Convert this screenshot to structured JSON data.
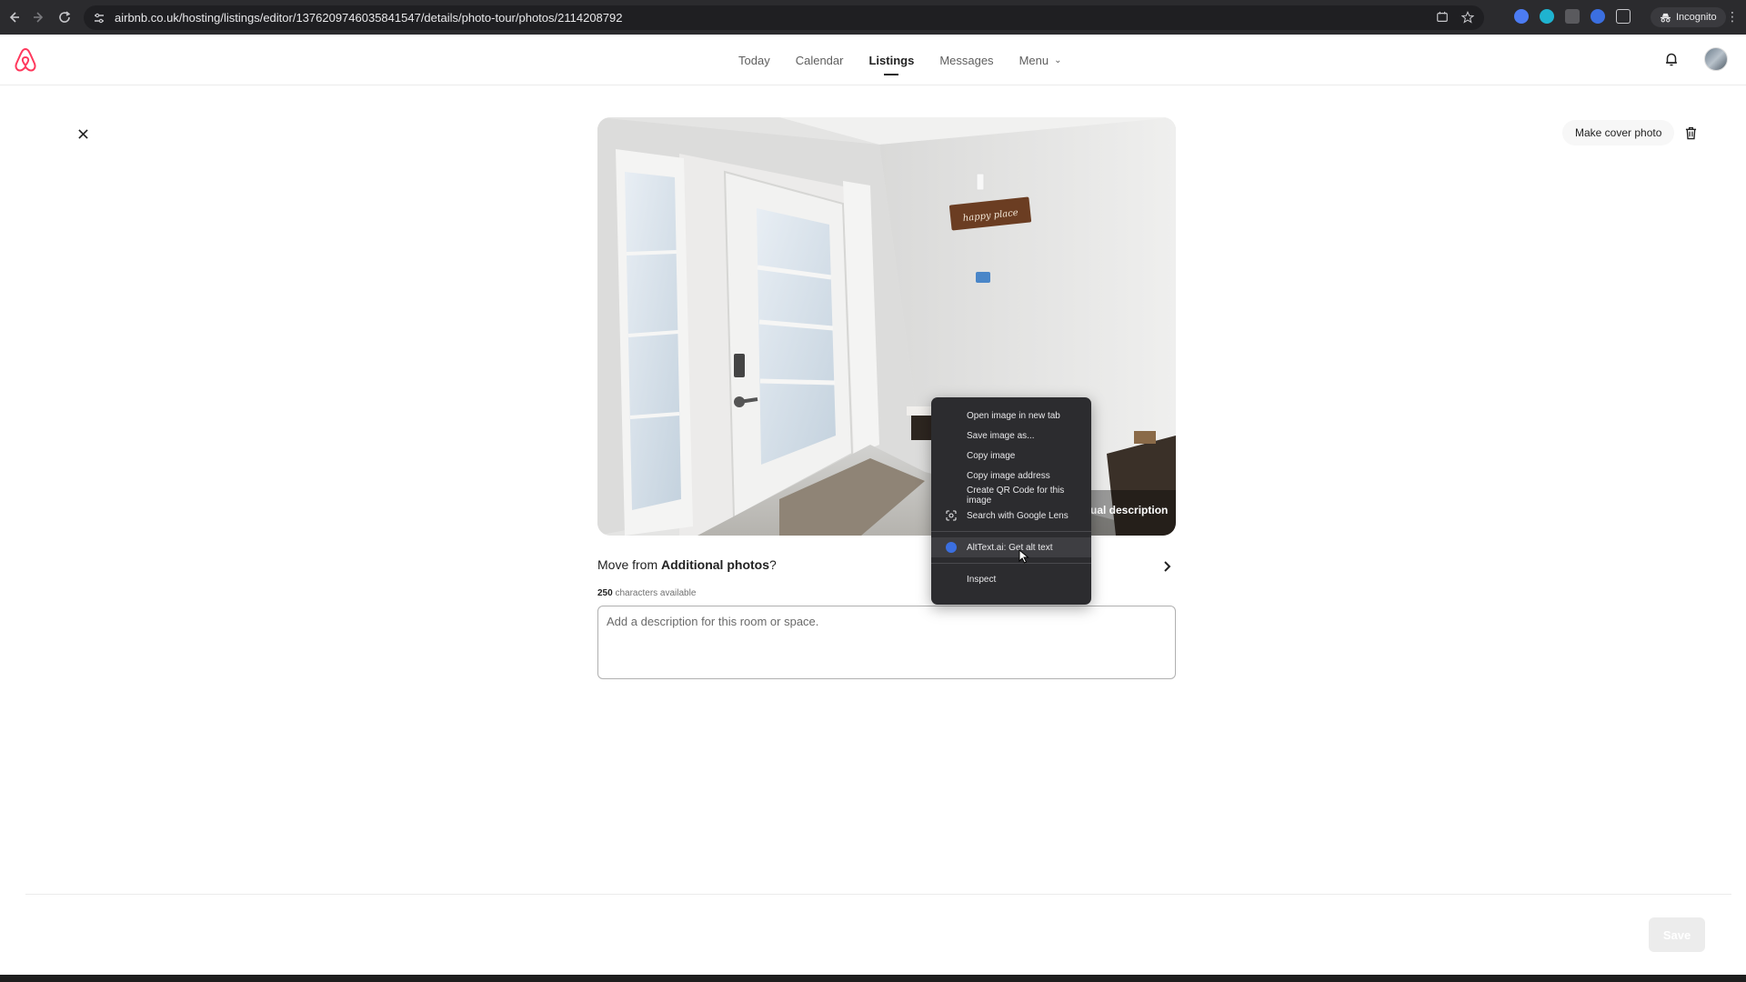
{
  "browser": {
    "url": "airbnb.co.uk/hosting/listings/editor/1376209746035841547/details/photo-tour/photos/2114208792",
    "incognito_label": "Incognito"
  },
  "header": {
    "nav": [
      {
        "label": "Today"
      },
      {
        "label": "Calendar"
      },
      {
        "label": "Listings"
      },
      {
        "label": "Messages"
      },
      {
        "label": "Menu"
      }
    ],
    "active_nav": "Listings"
  },
  "toolbar": {
    "cover_label": "Make cover photo"
  },
  "photo": {
    "sign_text": "happy place",
    "overlay_label": "ual description"
  },
  "move": {
    "prefix": "Move from ",
    "section": "Additional photos",
    "suffix": "?"
  },
  "description": {
    "chars_count": "250",
    "chars_suffix": " characters available",
    "placeholder": "Add a description for this room or space."
  },
  "footer": {
    "save_label": "Save"
  },
  "context_menu": {
    "items": [
      {
        "label": "Open image in new tab"
      },
      {
        "label": "Save image as..."
      },
      {
        "label": "Copy image"
      },
      {
        "label": "Copy image address"
      },
      {
        "label": "Create QR Code for this image"
      },
      {
        "label": "Search with Google Lens"
      },
      {
        "label": "AltText.ai: Get alt text"
      },
      {
        "label": "Inspect"
      }
    ]
  },
  "colors": {
    "brand": "#ff385c",
    "chrome_bg": "#2b2b2e",
    "menu_bg": "#2c2c2f"
  }
}
